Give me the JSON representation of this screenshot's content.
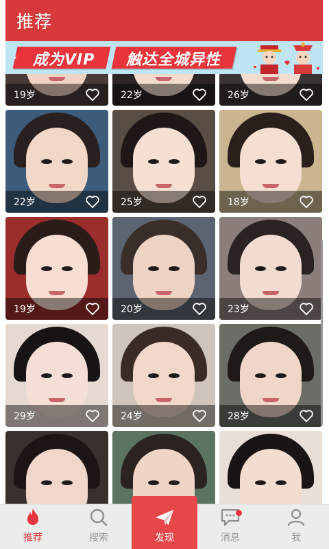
{
  "header": {
    "title": "推荐"
  },
  "banner": {
    "text_left": "成为VIP",
    "text_right": "触达全城异性"
  },
  "profiles": [
    {
      "age": "19岁",
      "skin": "#f1d3c3",
      "hair": "#2a1e1c",
      "bg": "#4a3b38"
    },
    {
      "age": "22岁",
      "skin": "#f3dbcc",
      "hair": "#3a2a26",
      "bg": "#2b2526"
    },
    {
      "age": "26岁",
      "skin": "#f4ddd0",
      "hair": "#2c2220",
      "bg": "#3b3434"
    },
    {
      "age": "22岁",
      "skin": "#f2d8c8",
      "hair": "#2a2020",
      "bg": "#3d5b7a"
    },
    {
      "age": "25岁",
      "skin": "#f6e0d4",
      "hair": "#1e1716",
      "bg": "#5a4d44"
    },
    {
      "age": "18岁",
      "skin": "#f5dfd2",
      "hair": "#2a1f1b",
      "bg": "#c9b58f"
    },
    {
      "age": "19岁",
      "skin": "#f7ddd2",
      "hair": "#2a1c18",
      "bg": "#9b2d2d"
    },
    {
      "age": "20岁",
      "skin": "#edd3c3",
      "hair": "#3a2e2a",
      "bg": "#5b6470"
    },
    {
      "age": "23岁",
      "skin": "#f2dcd2",
      "hair": "#2b2322",
      "bg": "#8c7e7a"
    },
    {
      "age": "29岁",
      "skin": "#f5ded6",
      "hair": "#191414",
      "bg": "#e6d9d2"
    },
    {
      "age": "24岁",
      "skin": "#f2d8ca",
      "hair": "#3a2b25",
      "bg": "#cfc4bb"
    },
    {
      "age": "28岁",
      "skin": "#f0d6c9",
      "hair": "#1f1a18",
      "bg": "#6a6e66"
    },
    {
      "age": "",
      "skin": "#f1d7cb",
      "hair": "#1d1514",
      "bg": "#3a302d"
    },
    {
      "age": "",
      "skin": "#f0d5c6",
      "hair": "#2b2320",
      "bg": "#5b7462"
    },
    {
      "age": "",
      "skin": "#f3dcd0",
      "hair": "#1a1414",
      "bg": "#eadfd8"
    }
  ],
  "nav": {
    "items": [
      {
        "label": "推荐",
        "icon": "flame-icon",
        "active": true
      },
      {
        "label": "搜索",
        "icon": "search-icon",
        "active": false
      },
      {
        "label": "发现",
        "icon": "paper-plane-icon",
        "active": false,
        "center": true
      },
      {
        "label": "消息",
        "icon": "message-icon",
        "active": false,
        "badge": true
      },
      {
        "label": "我",
        "icon": "user-icon",
        "active": false
      }
    ]
  },
  "colors": {
    "accent": "#d8393a",
    "nav_center": "#e8474a",
    "banner_bg": "#bfe4f2"
  }
}
